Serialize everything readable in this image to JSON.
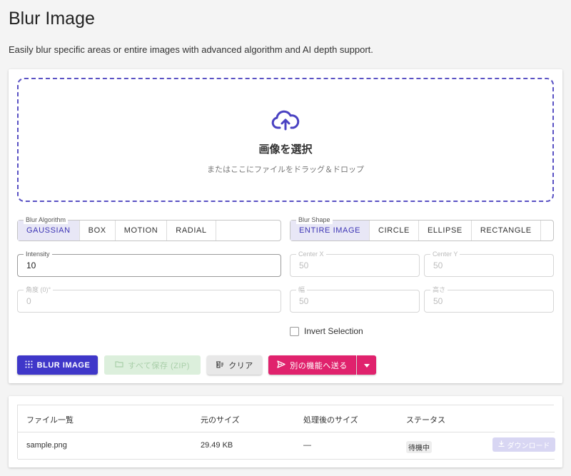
{
  "header": {
    "title": "Blur Image",
    "subtitle": "Easily blur specific areas or entire images with advanced algorithm and AI depth support."
  },
  "dropzone": {
    "icon": "cloud-upload-icon",
    "title": "画像を選択",
    "hint": "またはここにファイルをドラッグ＆ドロップ"
  },
  "algorithm": {
    "legend": "Blur Algorithm",
    "options": [
      "GAUSSIAN",
      "BOX",
      "MOTION",
      "RADIAL"
    ],
    "selected": "GAUSSIAN"
  },
  "shape": {
    "legend": "Blur Shape",
    "options": [
      "ENTIRE IMAGE",
      "CIRCLE",
      "ELLIPSE",
      "RECTANGLE"
    ],
    "selected": "ENTIRE IMAGE"
  },
  "fields": {
    "intensity": {
      "label": "Intensity",
      "value": "10"
    },
    "center_x": {
      "label": "Center X",
      "value": "50"
    },
    "center_y": {
      "label": "Center Y",
      "value": "50"
    },
    "angle": {
      "label": "角度 (0)°",
      "value": "0"
    },
    "width": {
      "label": "幅",
      "value": "50"
    },
    "height": {
      "label": "高さ",
      "value": "50"
    }
  },
  "invert": {
    "label": "Invert Selection",
    "checked": false
  },
  "actions": {
    "blur": "BLUR IMAGE",
    "save_all": "すべて保存 (ZIP)",
    "clear": "クリア",
    "send": "別の機能へ送る"
  },
  "table": {
    "headers": [
      "ファイル一覧",
      "元のサイズ",
      "処理後のサイズ",
      "ステータス"
    ],
    "rows": [
      {
        "name": "sample.png",
        "original_size": "29.49 KB",
        "processed_size": "—",
        "status": "待機中",
        "action": "ダウンロード"
      }
    ]
  },
  "colors": {
    "primary": "#3f37c9",
    "accent": "#e0226d",
    "success_disabled": "#dcefdc"
  }
}
